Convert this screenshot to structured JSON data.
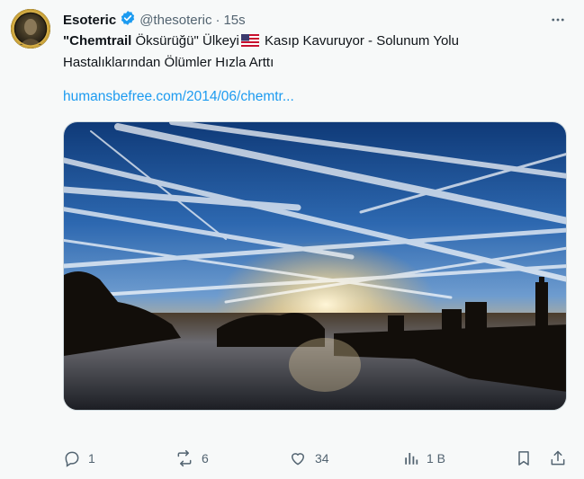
{
  "author": {
    "name": "Esoteric",
    "handle": "@thesoteric",
    "separator": "·",
    "time": "15s"
  },
  "tweet": {
    "bold_part": "\"Chemtrail",
    "part_after_bold": " Öksürüğü\" Ülkeyi",
    "flag": "us-flag-icon",
    "part_after_flag": " Kasıp Kavuruyor - Solunum Yolu Hastalıklarından Ölümler Hızla Arttı",
    "link": "humansbefree.com/2014/06/chemtr..."
  },
  "actions": {
    "replies": "1",
    "reposts": "6",
    "likes": "34",
    "views": "1 B"
  },
  "colors": {
    "accent": "#1d9bf0",
    "secondary_text": "#536471",
    "background": "#f7f9f9"
  }
}
